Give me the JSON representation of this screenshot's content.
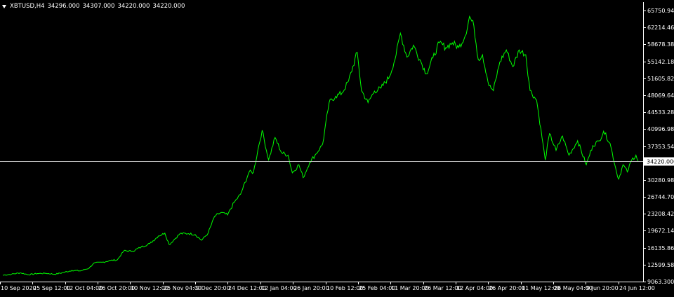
{
  "header": {
    "symbol_timeframe": "XBTUSD,H4",
    "ohlc": [
      "34296.000",
      "34307.000",
      "34220.000",
      "34220.000"
    ]
  },
  "colors": {
    "background": "#000000",
    "price_line": "#00FF00",
    "foreground": "#FFFFFF",
    "current_price_line": "#C0C0C0"
  },
  "chart_data": {
    "type": "line",
    "title": "XBTUSD,H4",
    "grid": false,
    "y_axis": {
      "side": "right",
      "min": 9063.33,
      "max": 65750.94,
      "ticks": [
        "65750.940",
        "62214.460",
        "58678.380",
        "55142.180",
        "51605.820",
        "48069.640",
        "44533.280",
        "40996.980",
        "37353.540",
        "34220.000",
        "30280.980",
        "26744.700",
        "23208.420",
        "19672.140",
        "16135.860",
        "12599.580",
        "9063.300"
      ]
    },
    "x_axis": {
      "ticks": [
        "10 Sep 2020",
        "25 Sep 12:00",
        "12 Oct 04:00",
        "26 Oct 20:00",
        "10 Nov 12:00",
        "25 Nov 04:00",
        "9 Dec 20:00",
        "24 Dec 12:00",
        "12 Jan 04:00",
        "26 Jan 20:00",
        "10 Feb 12:00",
        "25 Feb 04:00",
        "11 Mar 20:00",
        "26 Mar 12:00",
        "12 Apr 04:00",
        "26 Apr 20:00",
        "11 May 12:00",
        "26 May 04:00",
        "9 Jun 20:00",
        "24 Jun 12:00"
      ]
    },
    "current_price": 34220.0,
    "current_price_label": "34220.000",
    "series": [
      {
        "points": [
          {
            "x": "2020-09-10",
            "y": 10400
          },
          {
            "x": "2020-09-14",
            "y": 10600
          },
          {
            "x": "2020-09-18",
            "y": 10900
          },
          {
            "x": "2020-09-22",
            "y": 10500
          },
          {
            "x": "2020-09-26",
            "y": 10750
          },
          {
            "x": "2020-09-30",
            "y": 10800
          },
          {
            "x": "2020-10-04",
            "y": 10600
          },
          {
            "x": "2020-10-08",
            "y": 10950
          },
          {
            "x": "2020-10-12",
            "y": 11400
          },
          {
            "x": "2020-10-16",
            "y": 11300
          },
          {
            "x": "2020-10-20",
            "y": 11900
          },
          {
            "x": "2020-10-22",
            "y": 12900
          },
          {
            "x": "2020-10-26",
            "y": 13100
          },
          {
            "x": "2020-10-30",
            "y": 13500
          },
          {
            "x": "2020-11-02",
            "y": 13600
          },
          {
            "x": "2020-11-05",
            "y": 15500
          },
          {
            "x": "2020-11-09",
            "y": 15400
          },
          {
            "x": "2020-11-13",
            "y": 16300
          },
          {
            "x": "2020-11-17",
            "y": 17000
          },
          {
            "x": "2020-11-21",
            "y": 18600
          },
          {
            "x": "2020-11-24",
            "y": 19200
          },
          {
            "x": "2020-11-26",
            "y": 16800
          },
          {
            "x": "2020-11-28",
            "y": 17700
          },
          {
            "x": "2020-12-01",
            "y": 19100
          },
          {
            "x": "2020-12-05",
            "y": 19100
          },
          {
            "x": "2020-12-08",
            "y": 18900
          },
          {
            "x": "2020-12-11",
            "y": 17700
          },
          {
            "x": "2020-12-14",
            "y": 19200
          },
          {
            "x": "2020-12-17",
            "y": 22700
          },
          {
            "x": "2020-12-20",
            "y": 23500
          },
          {
            "x": "2020-12-23",
            "y": 23000
          },
          {
            "x": "2020-12-26",
            "y": 25600
          },
          {
            "x": "2020-12-29",
            "y": 27300
          },
          {
            "x": "2021-01-02",
            "y": 32000
          },
          {
            "x": "2021-01-04",
            "y": 31900
          },
          {
            "x": "2021-01-06",
            "y": 36500
          },
          {
            "x": "2021-01-08",
            "y": 40700
          },
          {
            "x": "2021-01-11",
            "y": 34500
          },
          {
            "x": "2021-01-14",
            "y": 39200
          },
          {
            "x": "2021-01-17",
            "y": 36000
          },
          {
            "x": "2021-01-20",
            "y": 35500
          },
          {
            "x": "2021-01-22",
            "y": 31800
          },
          {
            "x": "2021-01-25",
            "y": 33500
          },
          {
            "x": "2021-01-27",
            "y": 30800
          },
          {
            "x": "2021-01-30",
            "y": 34000
          },
          {
            "x": "2021-02-02",
            "y": 35800
          },
          {
            "x": "2021-02-05",
            "y": 37800
          },
          {
            "x": "2021-02-08",
            "y": 46500
          },
          {
            "x": "2021-02-11",
            "y": 47800
          },
          {
            "x": "2021-02-14",
            "y": 48500
          },
          {
            "x": "2021-02-17",
            "y": 51000
          },
          {
            "x": "2021-02-21",
            "y": 57000
          },
          {
            "x": "2021-02-23",
            "y": 49000
          },
          {
            "x": "2021-02-26",
            "y": 46500
          },
          {
            "x": "2021-03-01",
            "y": 48900
          },
          {
            "x": "2021-03-04",
            "y": 49500
          },
          {
            "x": "2021-03-08",
            "y": 52000
          },
          {
            "x": "2021-03-11",
            "y": 56500
          },
          {
            "x": "2021-03-13",
            "y": 61000
          },
          {
            "x": "2021-03-16",
            "y": 56000
          },
          {
            "x": "2021-03-19",
            "y": 58500
          },
          {
            "x": "2021-03-22",
            "y": 55500
          },
          {
            "x": "2021-03-25",
            "y": 52500
          },
          {
            "x": "2021-03-28",
            "y": 55800
          },
          {
            "x": "2021-03-31",
            "y": 59000
          },
          {
            "x": "2021-04-03",
            "y": 58000
          },
          {
            "x": "2021-04-06",
            "y": 59000
          },
          {
            "x": "2021-04-09",
            "y": 58000
          },
          {
            "x": "2021-04-12",
            "y": 60500
          },
          {
            "x": "2021-04-14",
            "y": 64500
          },
          {
            "x": "2021-04-16",
            "y": 62500
          },
          {
            "x": "2021-04-18",
            "y": 55500
          },
          {
            "x": "2021-04-20",
            "y": 56500
          },
          {
            "x": "2021-04-23",
            "y": 50000
          },
          {
            "x": "2021-04-25",
            "y": 49000
          },
          {
            "x": "2021-04-28",
            "y": 55000
          },
          {
            "x": "2021-05-01",
            "y": 57500
          },
          {
            "x": "2021-05-04",
            "y": 54000
          },
          {
            "x": "2021-05-07",
            "y": 57500
          },
          {
            "x": "2021-05-10",
            "y": 56500
          },
          {
            "x": "2021-05-12",
            "y": 49000
          },
          {
            "x": "2021-05-15",
            "y": 47000
          },
          {
            "x": "2021-05-16",
            "y": 44000
          },
          {
            "x": "2021-05-19",
            "y": 34500
          },
          {
            "x": "2021-05-21",
            "y": 40000
          },
          {
            "x": "2021-05-24",
            "y": 36500
          },
          {
            "x": "2021-05-27",
            "y": 39500
          },
          {
            "x": "2021-05-30",
            "y": 35500
          },
          {
            "x": "2021-06-03",
            "y": 38500
          },
          {
            "x": "2021-06-07",
            "y": 33500
          },
          {
            "x": "2021-06-10",
            "y": 37500
          },
          {
            "x": "2021-06-13",
            "y": 38500
          },
          {
            "x": "2021-06-15",
            "y": 40500
          },
          {
            "x": "2021-06-18",
            "y": 38000
          },
          {
            "x": "2021-06-21",
            "y": 32000
          },
          {
            "x": "2021-06-22",
            "y": 30500
          },
          {
            "x": "2021-06-24",
            "y": 33500
          },
          {
            "x": "2021-06-26",
            "y": 32000
          },
          {
            "x": "2021-06-28",
            "y": 34500
          },
          {
            "x": "2021-06-30",
            "y": 35500
          },
          {
            "x": "2021-07-01",
            "y": 34220
          }
        ]
      }
    ]
  }
}
